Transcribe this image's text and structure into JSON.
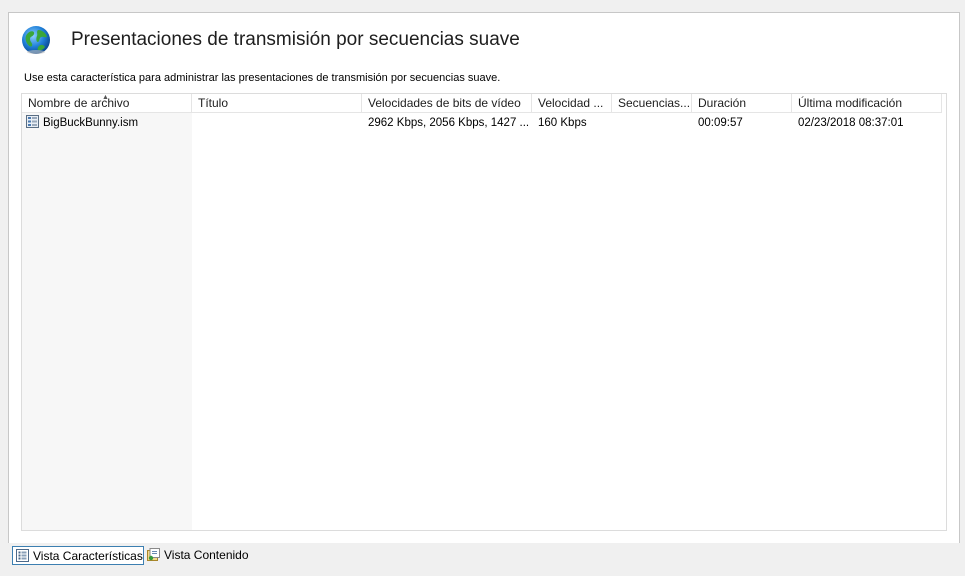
{
  "header": {
    "title": "Presentaciones de transmisión por secuencias suave",
    "description": "Use esta característica para administrar las presentaciones de transmisión por secuencias suave.",
    "icon": "globe-icon"
  },
  "list": {
    "columns": [
      "Nombre de archivo",
      "Título",
      "Velocidades de bits de vídeo",
      "Velocidad ...",
      "Secuencias...",
      "Duración",
      "Última modificación"
    ],
    "sorted_column": "Nombre de archivo",
    "rows": [
      {
        "file": "BigBuckBunny.ism",
        "title": "",
        "video_bitrates": "2962 Kbps, 2056 Kbps, 1427 ...",
        "speed": "160 Kbps",
        "streams": "",
        "duration": "00:09:57",
        "modified": "02/23/2018 08:37:01"
      }
    ]
  },
  "footer": {
    "features_view": "Vista Características",
    "content_view": "Vista Contenido",
    "active_view": "Vista Características"
  },
  "colors": {
    "active_border": "#3c7fb1",
    "sorted_column_bg": "#f7f7f7"
  }
}
